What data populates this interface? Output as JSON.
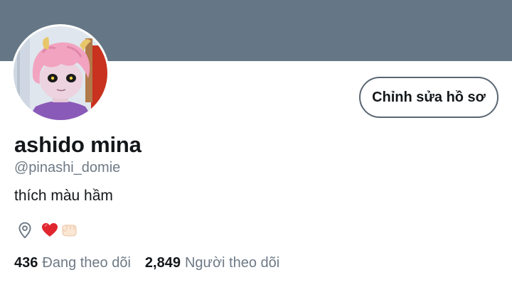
{
  "colors": {
    "banner": "#657786",
    "text_primary": "#14171a",
    "text_secondary": "#6e7a86",
    "button_border": "#5a6673"
  },
  "profile": {
    "display_name": "ashido mina",
    "handle": "@pinashi_domie",
    "bio": "thích màu hầm",
    "location": "❤️🤛🏻",
    "location_icon": "location-pin-icon"
  },
  "actions": {
    "edit_label": "Chỉnh sửa hồ sơ"
  },
  "stats": {
    "following_count": "436",
    "following_label": "Đang theo dõi",
    "followers_count": "2,849",
    "followers_label": "Người theo dõi"
  }
}
